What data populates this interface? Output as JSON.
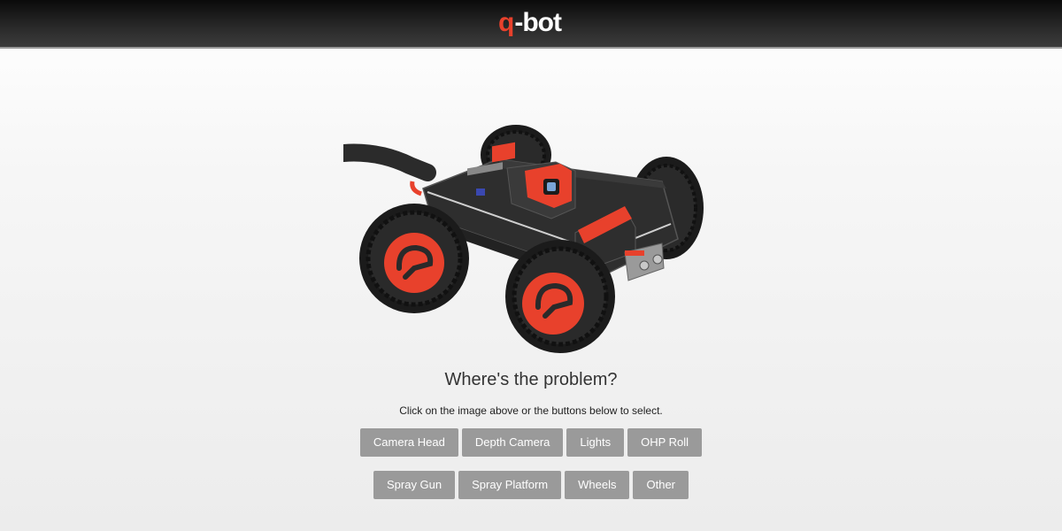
{
  "header": {
    "logo_q": "q",
    "logo_rest": "-bot"
  },
  "main": {
    "heading": "Where's the problem?",
    "subtext": "Click on the image above or the buttons below to select."
  },
  "buttons_row1": [
    "Camera Head",
    "Depth Camera",
    "Lights",
    "OHP Roll"
  ],
  "buttons_row2": [
    "Spray Gun",
    "Spray Platform",
    "Wheels",
    "Other"
  ],
  "colors": {
    "brand_orange": "#e8412c",
    "button_gray": "#9a9a9a",
    "header_dark": "#1a1a1a"
  },
  "icons": {
    "robot": "robot-illustration"
  }
}
